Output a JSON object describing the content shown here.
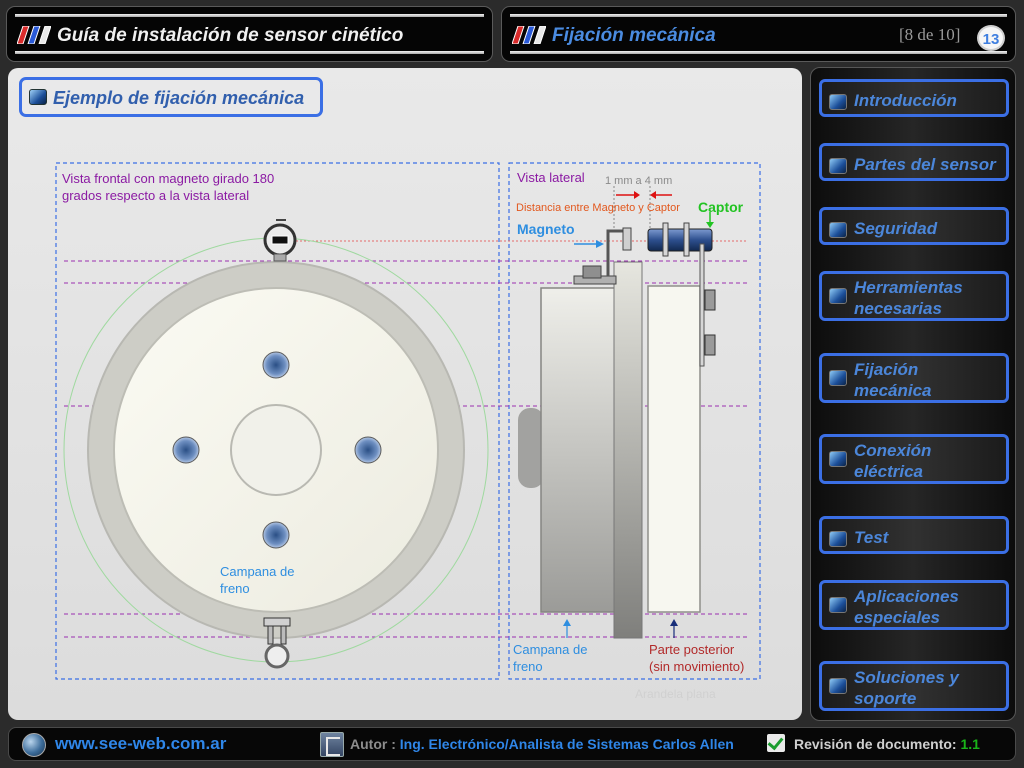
{
  "header_left": {
    "title": "Guía de instalación de sensor cinético"
  },
  "header_right": {
    "title": "Fijación mecánica",
    "page_count": "[8 de 10]",
    "page_number": "13"
  },
  "section": {
    "title": "Ejemplo de fijación mecánica"
  },
  "diagram": {
    "front": {
      "caption_line1": "Vista frontal con magneto girado 180",
      "caption_line2": "grados respecto a la vista lateral",
      "label_line1": "Campana de",
      "label_line2": "freno"
    },
    "side": {
      "title": "Vista lateral",
      "gap_range": "1 mm a 4 mm",
      "distance_label": "Distancia entre Magneto y Captor",
      "magnet_label": "Magneto",
      "sensor_label": "Captor",
      "bell_line1": "Campana de",
      "bell_line2": "freno",
      "rear_line1": "Parte posterior",
      "rear_line2": "(sin movimiento)",
      "washer_label": "Arandela plana"
    }
  },
  "sidebar": {
    "items": [
      {
        "line1": "Introducción"
      },
      {
        "line1": "Partes del sensor"
      },
      {
        "line1": "Seguridad"
      },
      {
        "line1": "Herramientas",
        "line2": "necesarias"
      },
      {
        "line1": "Fijación",
        "line2": "mecánica"
      },
      {
        "line1": "Conexión",
        "line2": "eléctrica"
      },
      {
        "line1": "Test"
      },
      {
        "line1": "Aplicaciones",
        "line2": "especiales"
      },
      {
        "line1": "Soluciones y",
        "line2": "soporte"
      }
    ]
  },
  "footer": {
    "website": "www.see-web.com.ar",
    "author_key": "Autor :",
    "author_value": "Ing. Electrónico/Analista de Sistemas Carlos Allen",
    "revision_key": "Revisión de documento:",
    "revision_value": "1.1"
  },
  "colors": {
    "accent_blue": "#3b6fe5",
    "title_blue": "#4a8be0",
    "link_blue": "#2f86e8",
    "revision_green": "#19b419",
    "caption_purple": "#8b1aa3",
    "distance_orange": "#e2581e",
    "sensor_green": "#22c322",
    "rear_red": "#b22a2a"
  },
  "icons": [
    "stripes-icon",
    "globe-icon",
    "document-icon",
    "check-icon",
    "nav-square-icon"
  ]
}
